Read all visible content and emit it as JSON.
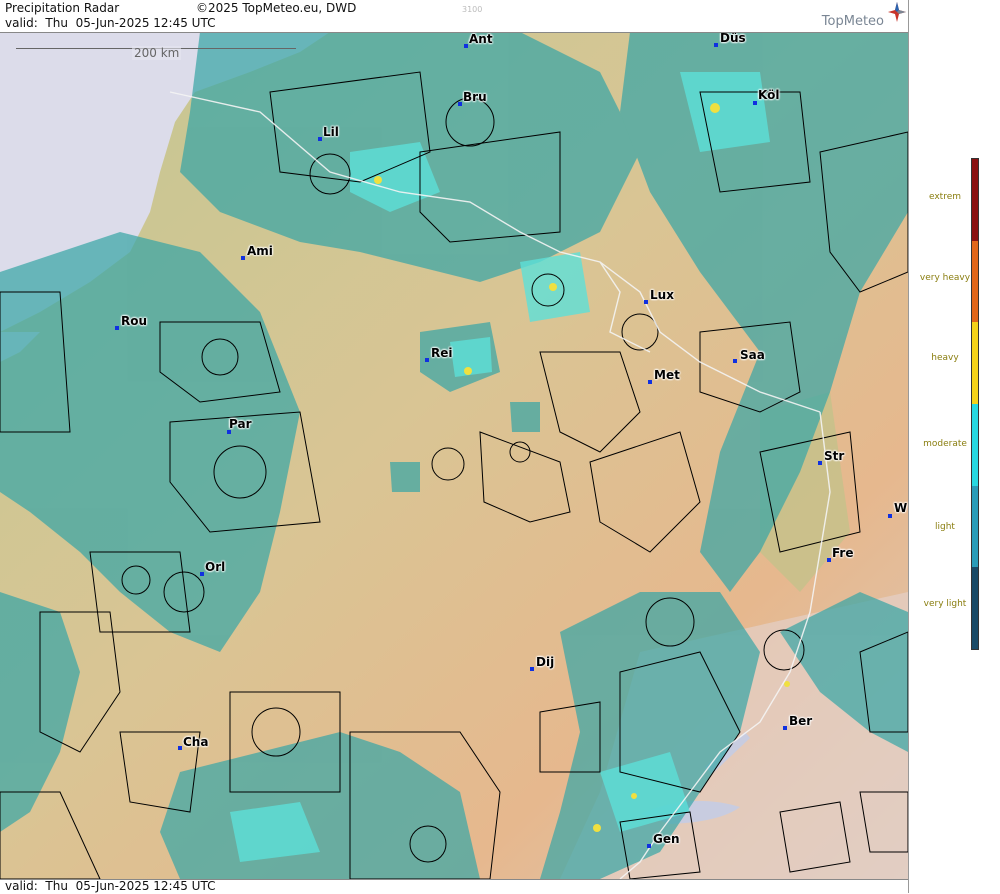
{
  "header": {
    "title": "Precipitation Radar",
    "valid": "valid:  Thu  05-Jun-2025 12:45 UTC",
    "copyright": "©2025 TopMeteo.eu, DWD",
    "faint_code": "3100",
    "brand": "TopMeteo"
  },
  "footer": {
    "valid": "valid:  Thu  05-Jun-2025 12:45 UTC"
  },
  "map": {
    "scale_label": "200 km",
    "cities": [
      {
        "name": "Ant"
      },
      {
        "name": "Düs"
      },
      {
        "name": "Bru"
      },
      {
        "name": "Köl"
      },
      {
        "name": "Lil"
      },
      {
        "name": "Ami"
      },
      {
        "name": "Lux"
      },
      {
        "name": "Rou"
      },
      {
        "name": "Rei"
      },
      {
        "name": "Saa"
      },
      {
        "name": "Met"
      },
      {
        "name": "Par"
      },
      {
        "name": "Str"
      },
      {
        "name": "W"
      },
      {
        "name": "Fre"
      },
      {
        "name": "Orl"
      },
      {
        "name": "Dij"
      },
      {
        "name": "Ber"
      },
      {
        "name": "Cha"
      },
      {
        "name": "Gen"
      }
    ]
  },
  "legend": {
    "items": [
      {
        "label": "extrem",
        "color": "#8a1010"
      },
      {
        "label": "very heavy",
        "color": "#e0661a"
      },
      {
        "label": "heavy",
        "color": "#f5d21a"
      },
      {
        "label": "moderate",
        "color": "#28d8e0"
      },
      {
        "label": "light",
        "color": "#2a9cb8"
      },
      {
        "label": "very light",
        "color": "#1a4a66"
      }
    ]
  },
  "colors": {
    "sea": "#dcdcea",
    "lowland": "#c8c690",
    "highland": "#e2b890",
    "alps": "#e8d8d4",
    "rain_light": "#3aa6a6",
    "rain_moderate": "#5ce0d8",
    "rain_heavy": "#f0e040"
  }
}
